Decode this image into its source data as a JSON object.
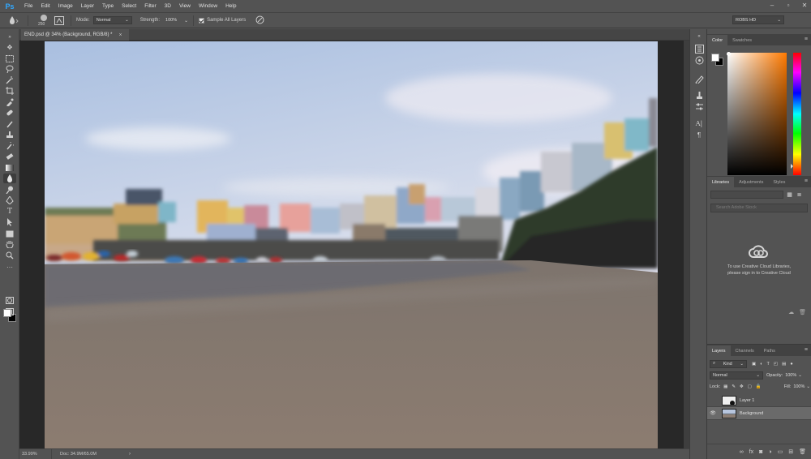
{
  "app": {
    "logo": "Ps",
    "menu": [
      "File",
      "Edit",
      "Image",
      "Layer",
      "Type",
      "Select",
      "Filter",
      "3D",
      "View",
      "Window",
      "Help"
    ]
  },
  "options": {
    "brush_size": "250",
    "mode_label": "Mode:",
    "mode_value": "Normal",
    "strength_label": "Strength:",
    "strength_value": "100%",
    "sample_all_layers": "Sample All Layers",
    "workspace": "ROBS HD"
  },
  "document": {
    "tab_title": "END.psd @ 34% (Background, RGB/8) *",
    "close": "×"
  },
  "status": {
    "zoom": "33.99%",
    "doc_size": "Doc: 34.9M/65.0M"
  },
  "panels": {
    "color_tabs": [
      "Color",
      "Swatches"
    ],
    "library_tabs": [
      "Libraries",
      "Adjustments",
      "Styles"
    ],
    "library_search_placeholder": "Search Adobe Stock",
    "library_message_1": "To use Creative Cloud Libraries,",
    "library_message_2": "please sign in to Creative Cloud",
    "layer_tabs": [
      "Layers",
      "Channels",
      "Paths"
    ],
    "kind_label": "Kind",
    "blend_mode": "Normal",
    "opacity_label": "Opacity:",
    "opacity_value": "100%",
    "lock_label": "Lock:",
    "fill_label": "Fill:",
    "fill_value": "100%",
    "layers": [
      {
        "name": "Layer 1",
        "visible": false,
        "selected": false
      },
      {
        "name": "Background",
        "visible": true,
        "selected": true
      }
    ]
  },
  "colors": {
    "chrome": "#535353",
    "canvas_bg": "#282828",
    "accent": "#31a8ff"
  }
}
